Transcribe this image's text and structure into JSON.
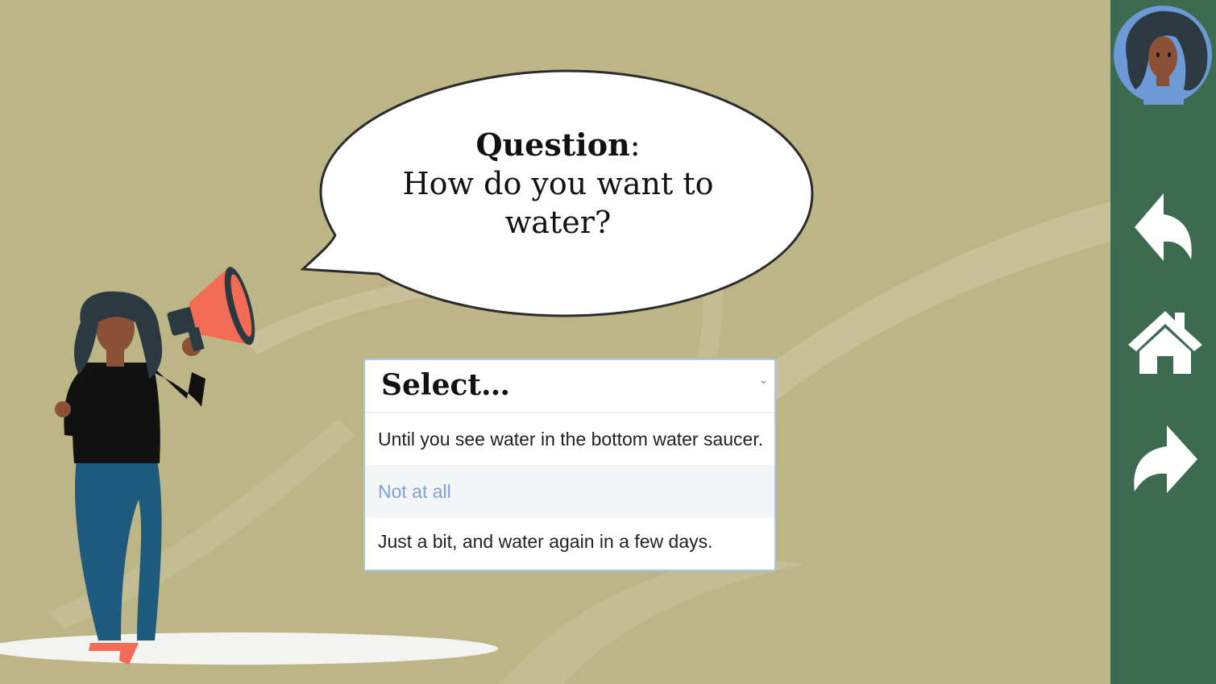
{
  "question": {
    "label": "Question",
    "separator": ":",
    "text": "How do you want to water?"
  },
  "dropdown": {
    "placeholder": "Select…",
    "chevron_icon": "chevron-down-icon",
    "options": [
      {
        "label": "Until you see water in the bottom water saucer."
      },
      {
        "label": "Not at all"
      },
      {
        "label": "Just a bit, and water again in a few days."
      }
    ],
    "highlighted_index": 1
  },
  "sidebar": {
    "avatar_icon": "avatar-woman-icon",
    "buttons": [
      {
        "name": "back",
        "icon": "back-arrow-icon"
      },
      {
        "name": "home",
        "icon": "home-icon"
      },
      {
        "name": "forward",
        "icon": "forward-arrow-icon"
      }
    ]
  },
  "colors": {
    "background": "#bcb585",
    "sidebar": "#3d6b4f",
    "highlight_text": "#7ea3d8",
    "megaphone": "#f36b55",
    "avatar_circle": "#6d9ad7"
  }
}
